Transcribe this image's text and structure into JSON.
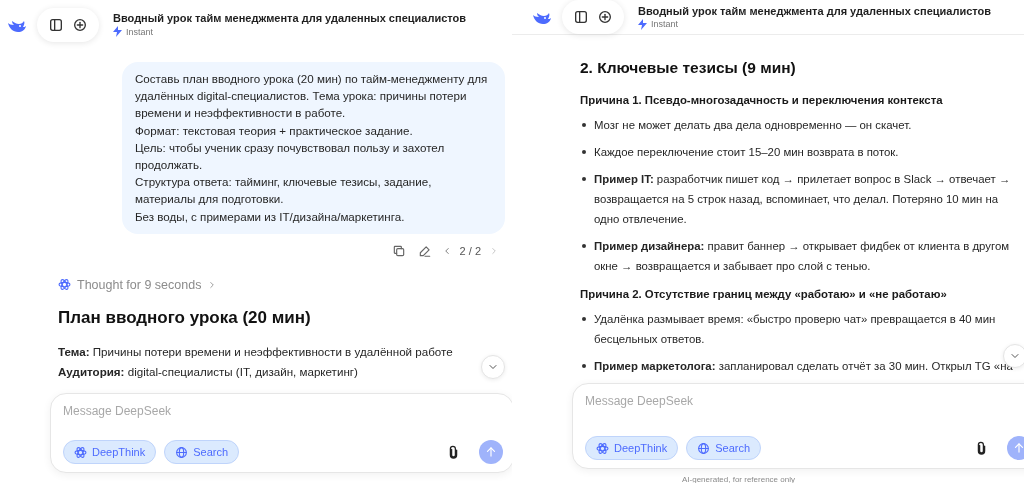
{
  "panels": [
    {
      "kind": "full",
      "header": {
        "title": "Вводный урок тайм менеджмента для удаленных специалистов",
        "mode": "Instant"
      },
      "user_message": {
        "text": "Составь план вводного урока (20 мин) по тайм-менеджменту для удалённых digital-специалистов. Тема урока: причины потери времени и неэффективности в работе.\nФормат: текстовая теория + практическое задание.\nЦель: чтобы ученик сразу почувствовал пользу и захотел продолжать.\nСтруктура ответа: тайминг, ключевые тезисы, задание, материалы для подготовки.\nБез воды, с примерами из IT/дизайна/маркетинга.",
        "version": "2 / 2"
      },
      "thought": "Thought for 9 seconds",
      "answer": [
        {
          "kind": "heading",
          "text": "План вводного урока (20 мин)"
        },
        {
          "kind": "field",
          "text": "**Тема:** Причины потери времени и неэффективности в удалённой работе"
        },
        {
          "kind": "field",
          "text": "**Аудитория:** digital-специалисты (IT, дизайн, маркетинг)"
        }
      ],
      "composer": {
        "placeholder": "Message DeepSeek",
        "toggles": [
          {
            "label": "DeepThink",
            "selected": true
          },
          {
            "label": "Search",
            "selected": true
          }
        ],
        "send_disabled": true
      }
    },
    {
      "kind": "compact",
      "header": {
        "title": "Вводный урок тайм менеджмента для удаленных специалистов",
        "mode": "Instant"
      },
      "answer": [
        {
          "kind": "heading",
          "text": "2. Ключевые тезисы (9 мин)"
        },
        {
          "kind": "subheading",
          "text": "Причина 1. Псевдо-многозадачность и переключения контекста"
        },
        {
          "kind": "bullet",
          "text": "Мозг не может делать два дела одновременно — он скачет."
        },
        {
          "kind": "bullet",
          "text": "Каждое переключение стоит 15–20 мин возврата в поток."
        },
        {
          "kind": "bullet",
          "text": "**Пример IT:** разработчик пишет код → прилетает вопрос в Slack → отвечает → возвращается на 5 строк назад, вспоминает, что делал. Потеряно 10 мин на одно отвлечение."
        },
        {
          "kind": "bullet",
          "text": "**Пример дизайнера:** правит баннер → открывает фидбек от клиента в другом окне → возвращается и забывает про слой с тенью."
        },
        {
          "kind": "subheading",
          "text": "Причина 2. Отсутствие границ между «работаю» и «не работаю»"
        },
        {
          "kind": "bullet",
          "text": "Удалёнка размывает время: «быстро проверю чат» превращается в 40 мин бесцельных ответов."
        },
        {
          "kind": "bullet",
          "text": "**Пример маркетолога:** запланировал сделать отчёт за 30 мин. Открыл TG «на"
        }
      ],
      "composer": {
        "placeholder": "Message DeepSeek",
        "toggles": [
          {
            "label": "DeepThink",
            "selected": true
          },
          {
            "label": "Search",
            "selected": true
          }
        ],
        "send_disabled": true
      },
      "footer": "AI-generated, for reference only"
    }
  ]
}
